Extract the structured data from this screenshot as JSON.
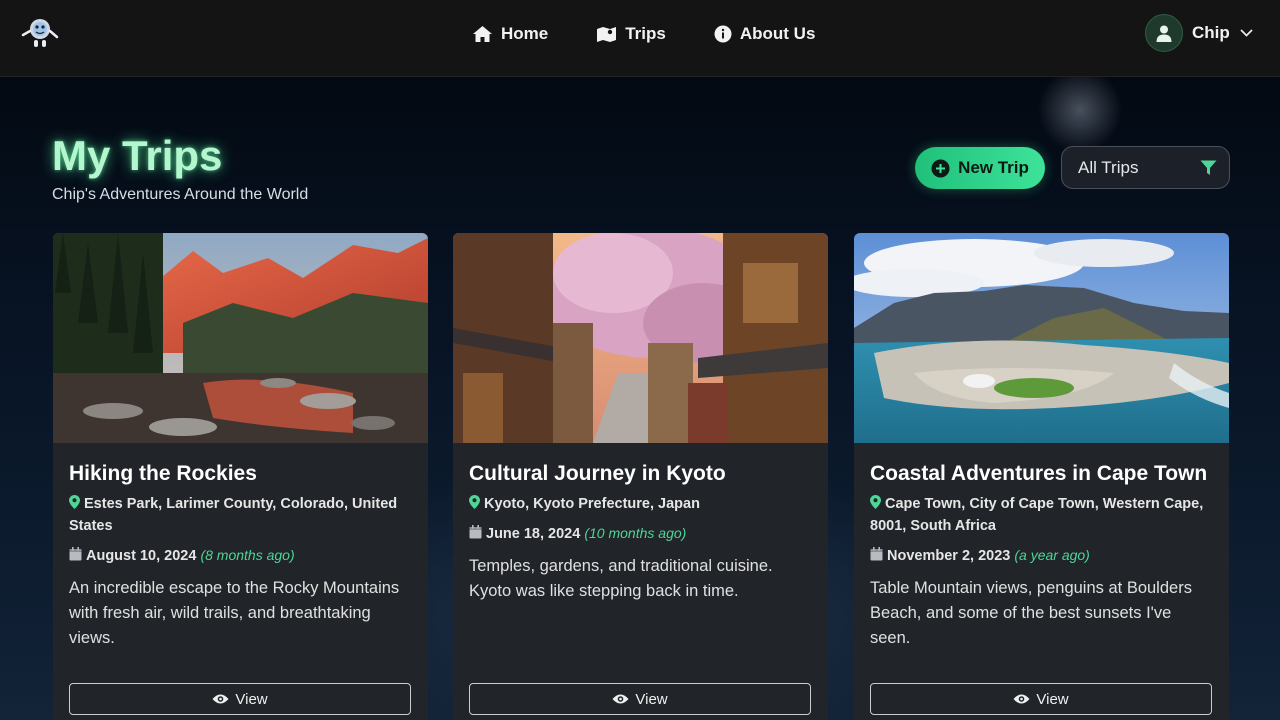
{
  "nav": {
    "home_label": "Home",
    "trips_label": "Trips",
    "about_label": "About Us",
    "user_name": "Chip"
  },
  "header": {
    "title": "My Trips",
    "subtitle": "Chip's Adventures Around the World",
    "new_trip_label": "New Trip",
    "filter_value": "All Trips"
  },
  "colors": {
    "accent_green": "#3ee39a",
    "title_glow": "#b4f7cf",
    "card_bg": "#212429"
  },
  "trips": [
    {
      "title": "Hiking the Rockies",
      "location": "Estes Park, Larimer County, Colorado, United States",
      "date": "August 10, 2024",
      "ago": "(8 months ago)",
      "description": "An incredible escape to the Rocky Mountains with fresh air, wild trails, and breathtaking views.",
      "view_label": "View"
    },
    {
      "title": "Cultural Journey in Kyoto",
      "location": "Kyoto, Kyoto Prefecture, Japan",
      "date": "June 18, 2024",
      "ago": "(10 months ago)",
      "description": "Temples, gardens, and traditional cuisine. Kyoto was like stepping back in time.",
      "view_label": "View"
    },
    {
      "title": "Coastal Adventures in Cape Town",
      "location": "Cape Town, City of Cape Town, Western Cape, 8001, South Africa",
      "date": "November 2, 2023",
      "ago": "(a year ago)",
      "description": "Table Mountain views, penguins at Boulders Beach, and some of the best sunsets I've seen.",
      "view_label": "View"
    }
  ]
}
